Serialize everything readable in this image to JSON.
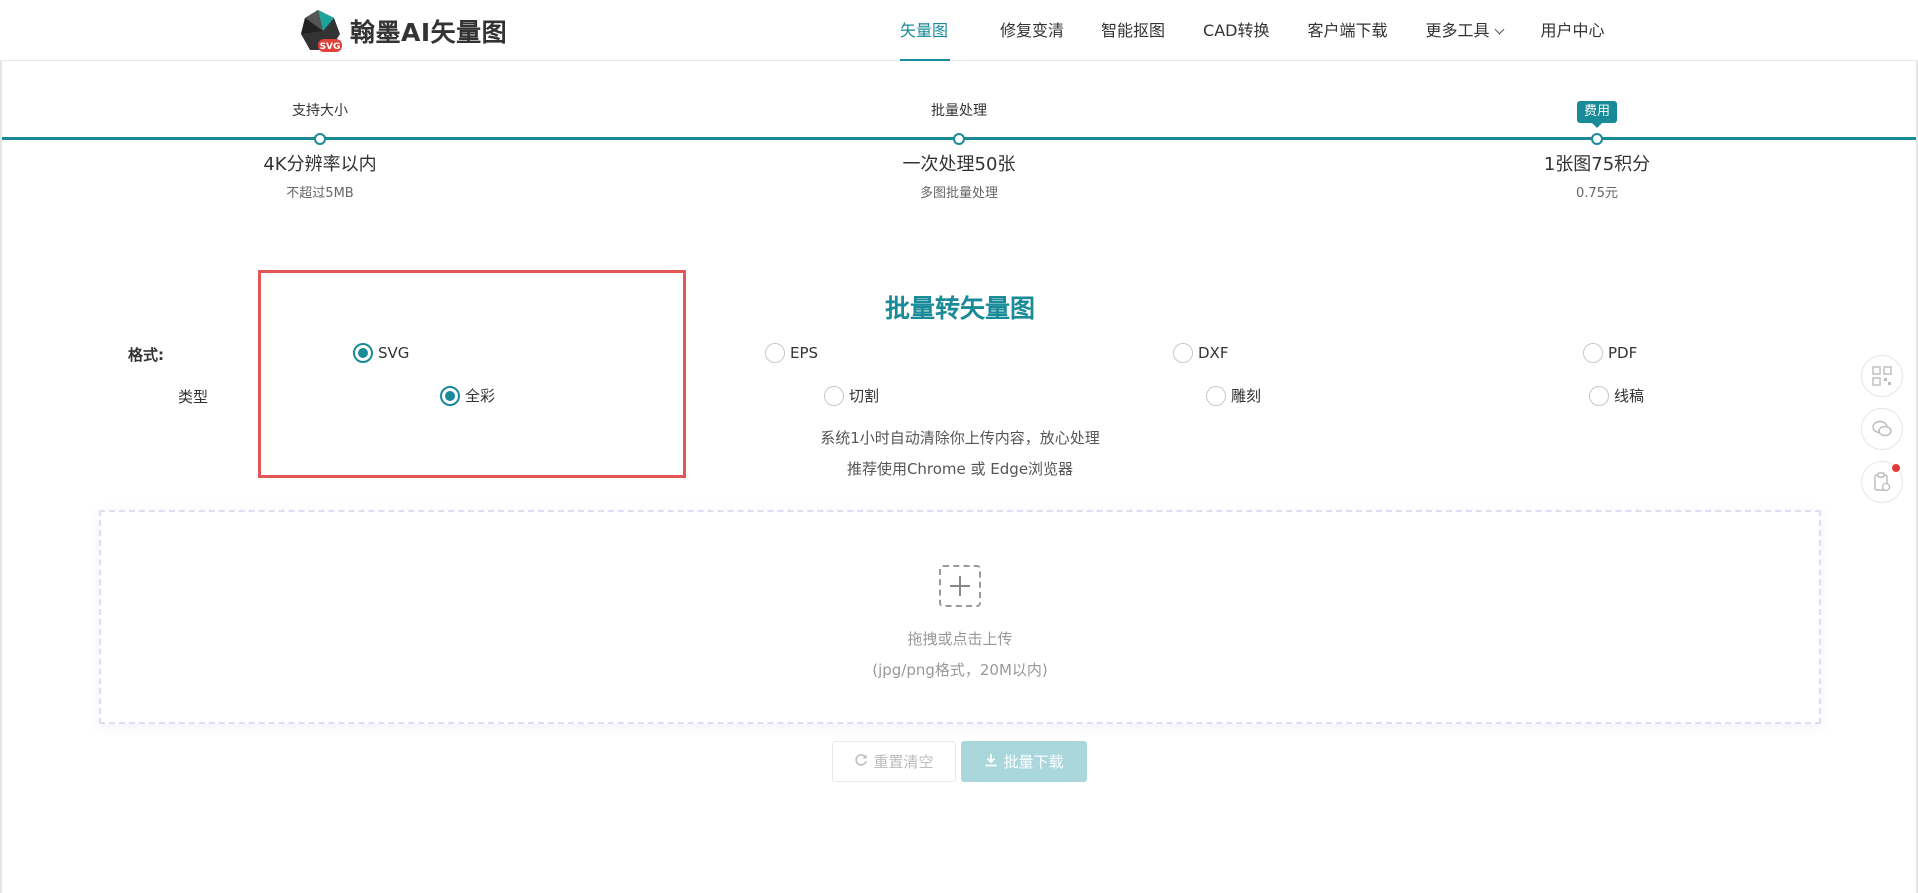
{
  "header": {
    "logo_text": "翰墨AI矢量图",
    "logo_badge": "SVG",
    "nav": [
      {
        "label": "矢量图",
        "active": true
      },
      {
        "label": "修复变清",
        "active": false
      },
      {
        "label": "智能抠图",
        "active": false
      },
      {
        "label": "CAD转换",
        "active": false
      },
      {
        "label": "客户端下载",
        "active": false
      },
      {
        "label": "更多工具",
        "active": false,
        "dropdown": true
      },
      {
        "label": "用户中心",
        "active": false
      }
    ]
  },
  "steps": [
    {
      "label": "支持大小",
      "value": "4K分辨率以内",
      "sub": "不超过5MB",
      "badge": false
    },
    {
      "label": "批量处理",
      "value": "一次处理50张",
      "sub": "多图批量处理",
      "badge": false
    },
    {
      "label": "费用",
      "value": "1张图75积分",
      "sub": "0.75元",
      "badge": true
    }
  ],
  "main": {
    "title": "批量转矢量图",
    "format_label": "格式:",
    "format_options": [
      {
        "label": "SVG",
        "checked": true
      },
      {
        "label": "EPS",
        "checked": false
      },
      {
        "label": "DXF",
        "checked": false
      },
      {
        "label": "PDF",
        "checked": false
      }
    ],
    "type_label": "类型",
    "type_options": [
      {
        "label": "全彩",
        "checked": true
      },
      {
        "label": "切割",
        "checked": false
      },
      {
        "label": "雕刻",
        "checked": false
      },
      {
        "label": "线稿",
        "checked": false
      }
    ],
    "notice_1": "系统1小时自动清除你上传内容，放心处理",
    "notice_2": "推荐使用Chrome 或 Edge浏览器"
  },
  "upload": {
    "primary": "拖拽或点击上传",
    "secondary": "(jpg/png格式，20M以内)"
  },
  "buttons": {
    "reset": "重置清空",
    "download": "批量下载"
  },
  "side_tools": [
    "qrcode-icon",
    "wechat-icon",
    "clipboard-icon"
  ],
  "colors": {
    "accent": "#188a98",
    "highlight": "#e45555"
  }
}
